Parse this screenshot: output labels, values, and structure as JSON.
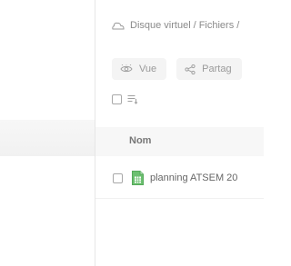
{
  "breadcrumb": {
    "items": [
      "Disque virtuel",
      "Fichiers /"
    ],
    "separator": "/",
    "icon": "cloud-icon"
  },
  "toolbar": {
    "view": {
      "label": "Vue",
      "icon": "eye-icon"
    },
    "share": {
      "label": "Partag",
      "icon": "share-icon"
    }
  },
  "selection": {
    "select_all_checked": false,
    "sort_icon": "sort-list-icon"
  },
  "table": {
    "columns": [
      "Nom"
    ],
    "rows": [
      {
        "name": "planning ATSEM 20",
        "icon": "spreadsheet-file-icon",
        "checked": false
      }
    ]
  },
  "colors": {
    "spreadsheet_green": "#6cc070",
    "muted_text": "#8a8a8a",
    "header_bg": "#f7f7f7"
  }
}
